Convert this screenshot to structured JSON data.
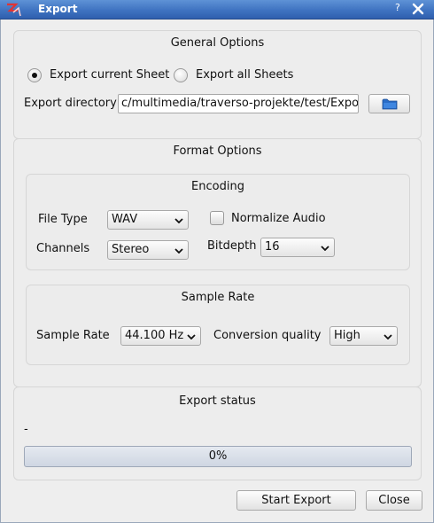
{
  "window": {
    "title": "Export",
    "help_glyph": "?",
    "icons": {
      "app": "traverso-app-icon",
      "close": "close-icon"
    }
  },
  "general": {
    "title": "General Options",
    "export_current_label": "Export current Sheet",
    "export_current_checked": true,
    "export_all_label": "Export all Sheets",
    "export_all_checked": false,
    "directory_label": "Export directory",
    "directory_value": "c/multimedia/traverso-projekte/test/Export/",
    "browse_icon": "folder-icon"
  },
  "format": {
    "title": "Format Options",
    "encoding": {
      "title": "Encoding",
      "file_type_label": "File Type",
      "file_type_value": "WAV",
      "normalize_label": "Normalize Audio",
      "normalize_checked": false,
      "channels_label": "Channels",
      "channels_value": "Stereo",
      "bitdepth_label": "Bitdepth",
      "bitdepth_value": "16"
    },
    "sample_rate": {
      "title": "Sample Rate",
      "rate_label": "Sample Rate",
      "rate_value": "44.100 Hz",
      "quality_label": "Conversion quality",
      "quality_value": "High"
    }
  },
  "status": {
    "title": "Export status",
    "message": "-",
    "progress_percent": 0,
    "progress_text": "0%"
  },
  "buttons": {
    "start_export": "Start Export",
    "close": "Close"
  }
}
